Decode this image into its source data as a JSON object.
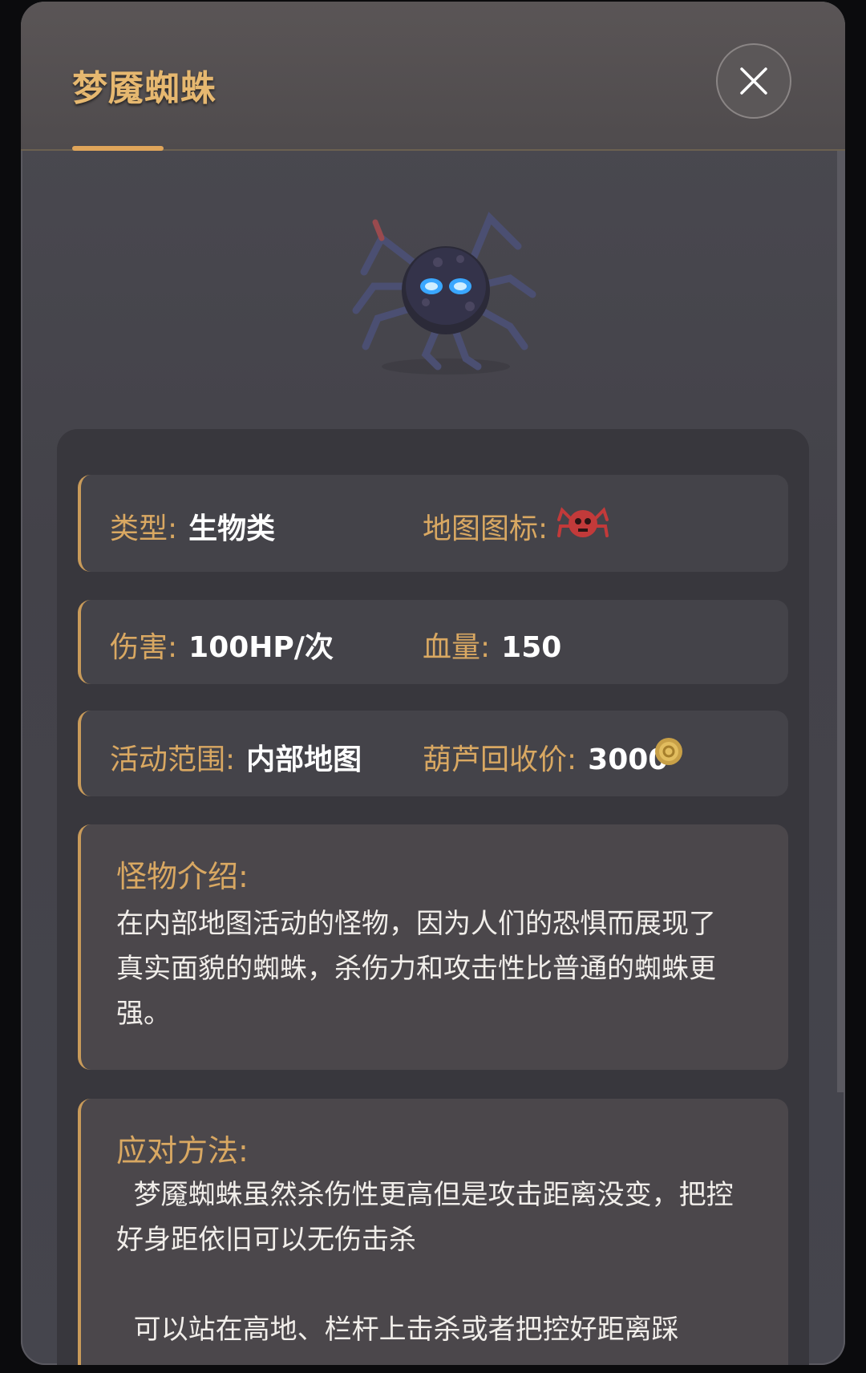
{
  "header": {
    "title": "梦魇蜘蛛"
  },
  "close_button": {
    "icon": "close-icon"
  },
  "monster": {
    "image_icon": "spider-icon"
  },
  "info": {
    "type_label": "类型:",
    "type_value": "生物类",
    "map_icon_label": "地图图标:",
    "map_icon_name": "red-spider-icon",
    "damage_label": "伤害:",
    "damage_value": "100HP/次",
    "hp_label": "血量:",
    "hp_value": "150",
    "range_label": "活动范围:",
    "range_value": "内部地图",
    "price_label": "葫芦回收价:",
    "price_value": "3000",
    "price_icon": "gold-coin-icon"
  },
  "intro": {
    "title": "怪物介绍:",
    "text": "在内部地图活动的怪物，因为人们的恐惧而展现了真实面貌的蜘蛛，杀伤力和攻击性比普通的蜘蛛更强。"
  },
  "strategy": {
    "title": "应对方法:",
    "text": "  梦魇蜘蛛虽然杀伤性更高但是攻击距离没变，把控好身距依旧可以无伤击杀\n\n  可以站在高地、栏杆上击杀或者把控好距离踩"
  },
  "colors": {
    "accent": "#d9a862",
    "panel": "#45454d",
    "card": "#38373d",
    "text": "#ffffff"
  }
}
